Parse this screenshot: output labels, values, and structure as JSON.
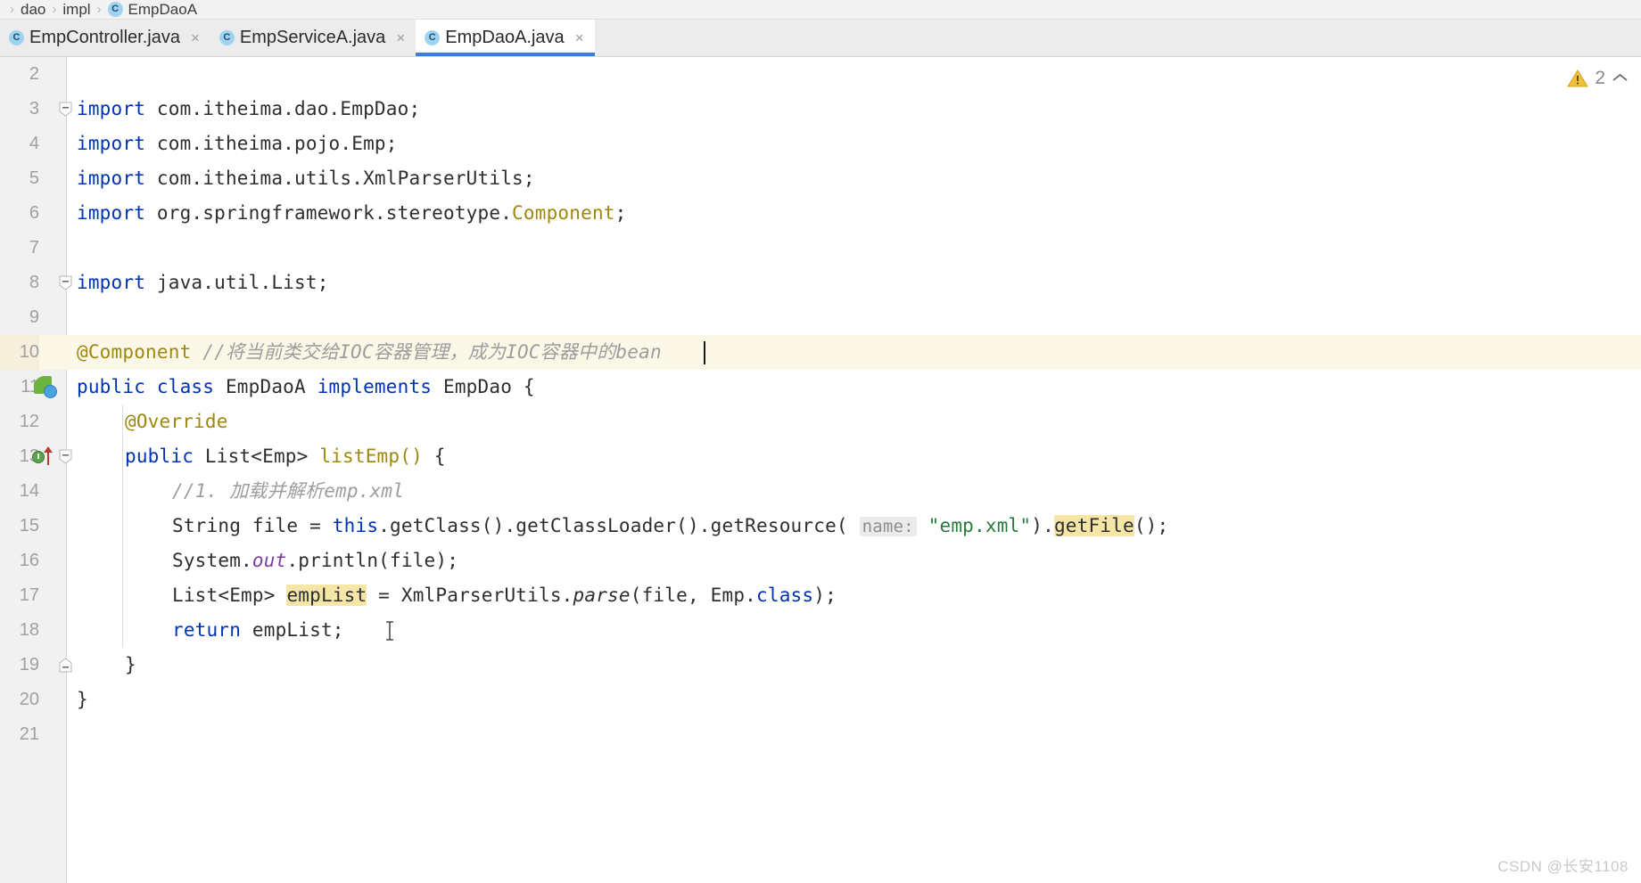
{
  "breadcrumb": {
    "separator": "›",
    "items": [
      {
        "label": "dao",
        "icon": ""
      },
      {
        "label": "impl",
        "icon": ""
      },
      {
        "label": "EmpDaoA",
        "icon": "java-class-icon",
        "badge": "C"
      }
    ]
  },
  "tabs": [
    {
      "label": "EmpController.java",
      "badge": "C",
      "close": "×",
      "active": false
    },
    {
      "label": "EmpServiceA.java",
      "badge": "C",
      "close": "×",
      "active": false
    },
    {
      "label": "EmpDaoA.java",
      "badge": "C",
      "close": "×",
      "active": true
    }
  ],
  "inspection": {
    "warning_icon": "warning-triangle-icon",
    "count": "2",
    "collapse_icon": "⌃"
  },
  "editor": {
    "caret_line": 10,
    "mouse_cursor_glyph": "⌶",
    "code_lines": [
      {
        "num": "2",
        "fold": "",
        "gutter": "",
        "text": ""
      },
      {
        "num": "3",
        "fold": "minus",
        "gutter": "",
        "text": "import com.itheima.dao.EmpDao;"
      },
      {
        "num": "4",
        "fold": "",
        "gutter": "",
        "text": "import com.itheima.pojo.Emp;"
      },
      {
        "num": "5",
        "fold": "",
        "gutter": "",
        "text": "import com.itheima.utils.XmlParserUtils;"
      },
      {
        "num": "6",
        "fold": "",
        "gutter": "",
        "text": "import org.springframework.stereotype.Component;"
      },
      {
        "num": "7",
        "fold": "",
        "gutter": "",
        "text": ""
      },
      {
        "num": "8",
        "fold": "collapse",
        "gutter": "",
        "text": "import java.util.List;"
      },
      {
        "num": "9",
        "fold": "",
        "gutter": "",
        "text": ""
      },
      {
        "num": "10",
        "fold": "",
        "gutter": "",
        "text": "@Component //将当前类交给IOC容器管理，成为IOC容器中的bean"
      },
      {
        "num": "11",
        "fold": "",
        "gutter": "spring-bean-icon",
        "text": "public class EmpDaoA implements EmpDao {"
      },
      {
        "num": "12",
        "fold": "",
        "gutter": "",
        "text": "    @Override"
      },
      {
        "num": "13",
        "fold": "minus",
        "gutter": "override-marker-icon",
        "text": "    public List<Emp> listEmp() {"
      },
      {
        "num": "14",
        "fold": "",
        "gutter": "",
        "text": "        //1. 加载并解析emp.xml"
      },
      {
        "num": "15",
        "fold": "",
        "gutter": "",
        "text": "        String file = this.getClass().getClassLoader().getResource( name: \"emp.xml\").getFile();"
      },
      {
        "num": "16",
        "fold": "",
        "gutter": "",
        "text": "        System.out.println(file);"
      },
      {
        "num": "17",
        "fold": "",
        "gutter": "",
        "text": "        List<Emp> empList = XmlParserUtils.parse(file, Emp.class);"
      },
      {
        "num": "18",
        "fold": "",
        "gutter": "",
        "text": "        return empList;"
      },
      {
        "num": "19",
        "fold": "collapse",
        "gutter": "",
        "text": "    }"
      },
      {
        "num": "20",
        "fold": "",
        "gutter": "",
        "text": "}"
      },
      {
        "num": "21",
        "fold": "",
        "gutter": "",
        "text": ""
      }
    ],
    "tokens": {
      "kw_import": "import",
      "kw_public": "public",
      "kw_class": "class",
      "kw_implements": "implements",
      "kw_this": "this",
      "kw_return": "return",
      "anno_component": "@Component",
      "anno_override": "@Override",
      "comment_component": "//将当前类交给IOC容器管理，成为IOC容器中的bean",
      "comment_parse": "//1. 加载并解析emp.xml",
      "param_hint_name": "name:",
      "string_emp_xml": "\"emp.xml\"",
      "highlight_getfile": "getFile",
      "highlight_emplist": "empList",
      "import_1": "com.itheima.dao.EmpDao;",
      "import_2": "com.itheima.pojo.Emp;",
      "import_3": "com.itheima.utils.XmlParserUtils;",
      "import_4a": "org.springframework.stereotype.",
      "import_4b": "Component",
      "import_4c": ";",
      "import_5": "java.util.List;",
      "class_decl_name": "EmpDaoA",
      "class_decl_iface": "EmpDao {",
      "method_sig_a": "List<Emp>",
      "method_sig_b": "listEmp()",
      "method_sig_c": "{",
      "l15_a": "String file = ",
      "l15_b": ".getClass().getClassLoader().getResource( ",
      "l15_c": ").",
      "l15_d": "();",
      "l16_a": "System.",
      "l16_b": "out",
      "l16_c": ".println(file);",
      "l17_a": "List<Emp> ",
      "l17_b": " = XmlParserUtils.",
      "l17_c": "parse",
      "l17_d": "(file, Emp.",
      "l17_e": "class",
      "l17_f": ");",
      "l18_b": " empList;",
      "brace_close_inner": "}",
      "brace_close_outer": "}"
    }
  },
  "watermark": "CSDN @长安1108",
  "colors": {
    "accent": "#3a7fd5",
    "keyword": "#0033b3",
    "annotation": "#9e880d",
    "comment": "#9d9d9d",
    "string": "#2a7a3b",
    "highlight": "#f5e6a8",
    "caret_line": "#fcf8e8",
    "warning": "#e8c027"
  }
}
